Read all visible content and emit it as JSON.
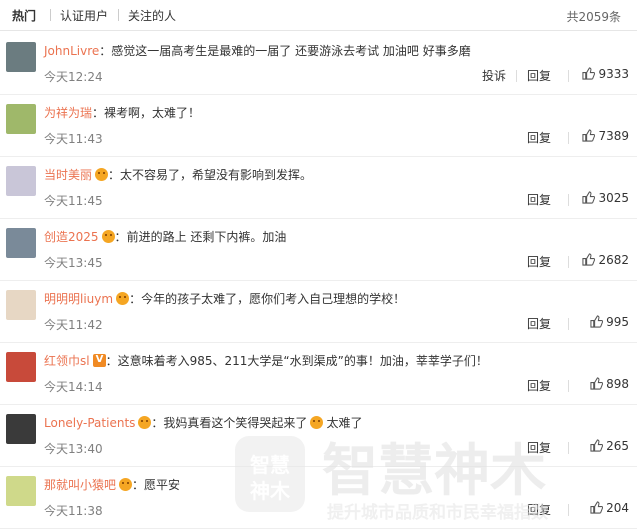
{
  "tabs": [
    {
      "label": "热门",
      "active": true
    },
    {
      "label": "认证用户",
      "active": false
    },
    {
      "label": "关注的人",
      "active": false
    }
  ],
  "total": "共2059条",
  "report_label": "投诉",
  "reply_label": "回复",
  "comments": [
    {
      "user": "JohnLivre",
      "badge": "",
      "sep": "：",
      "text": "感觉这一届高考生是最难的一届了 还要游泳去考试 加油吧 好事多磨",
      "time": "今天12:24",
      "report": true,
      "likes": "9333"
    },
    {
      "user": "为祥为瑞",
      "badge": "",
      "sep": "：",
      "text": "裸考啊，太难了！",
      "time": "今天11:43",
      "report": false,
      "likes": "7389"
    },
    {
      "user": "当时美丽",
      "badge": "emoji",
      "sep": "：",
      "text": "太不容易了，希望没有影响到发挥。",
      "time": "今天11:45",
      "report": false,
      "likes": "3025"
    },
    {
      "user": "创造2025",
      "badge": "emoji",
      "sep": "：",
      "text": "前进的路上 还剩下内裤。加油",
      "time": "今天13:45",
      "report": false,
      "likes": "2682"
    },
    {
      "user": "明明明liuym",
      "badge": "emoji",
      "sep": "：",
      "text": "今年的孩子太难了，愿你们考入自己理想的学校！",
      "time": "今天11:42",
      "report": false,
      "likes": "995"
    },
    {
      "user": "红领巾sl",
      "badge": "v",
      "sep": "：",
      "text": "这意味着考入985、211大学是“水到渠成”的事！加油，莘莘学子们！",
      "time": "今天14:14",
      "report": false,
      "likes": "898"
    },
    {
      "user": "Lonely-Patients",
      "badge": "emoji",
      "sep": "：",
      "text": "我妈真看这个笑得哭起来了",
      "text2": "太难了",
      "time": "今天13:40",
      "report": false,
      "likes": "265"
    },
    {
      "user": "那就叫小猿吧",
      "badge": "emoji",
      "sep": "：",
      "text": "愿平安",
      "time": "今天11:38",
      "report": false,
      "likes": "204"
    }
  ],
  "watermark": {
    "logo_text": "智慧神木",
    "tagline": "提升城市品质和市民幸福指数"
  },
  "colors": {
    "username": "#eb7350",
    "time": "#808080",
    "badge": "#f5a623"
  }
}
